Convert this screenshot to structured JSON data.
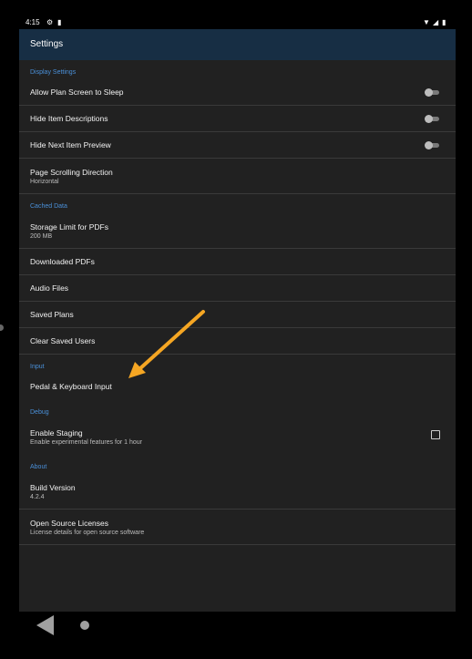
{
  "status_bar": {
    "time": "4:15",
    "icons": [
      "settings-icon",
      "sd-card-icon",
      "wifi-icon",
      "signal-icon",
      "battery-icon"
    ]
  },
  "app_bar": {
    "title": "Settings"
  },
  "sections": {
    "display": {
      "header": "Display Settings",
      "allow_sleep": {
        "label": "Allow Plan Screen to Sleep",
        "on": false
      },
      "hide_descriptions": {
        "label": "Hide Item Descriptions",
        "on": false
      },
      "hide_preview": {
        "label": "Hide Next Item Preview",
        "on": false
      },
      "scroll_direction": {
        "label": "Page Scrolling Direction",
        "value": "Horizontal"
      }
    },
    "cached": {
      "header": "Cached Data",
      "storage_limit": {
        "label": "Storage Limit for PDFs",
        "value": "200 MB"
      },
      "downloaded_pdfs": {
        "label": "Downloaded PDFs"
      },
      "audio_files": {
        "label": "Audio Files"
      },
      "saved_plans": {
        "label": "Saved Plans"
      },
      "clear_users": {
        "label": "Clear Saved Users"
      }
    },
    "input": {
      "header": "Input",
      "pedal_keyboard": {
        "label": "Pedal & Keyboard Input"
      }
    },
    "debug": {
      "header": "Debug",
      "staging": {
        "label": "Enable Staging",
        "desc": "Enable experimental features for 1 hour",
        "checked": false
      }
    },
    "about": {
      "header": "About",
      "build": {
        "label": "Build Version",
        "value": "4.2.4"
      },
      "licenses": {
        "label": "Open Source Licenses",
        "desc": "License details for open source software"
      }
    }
  },
  "colors": {
    "accent": "#4a90d9",
    "app_bar": "#172e44",
    "background": "#212121",
    "annotation_arrow": "#f5a623"
  }
}
